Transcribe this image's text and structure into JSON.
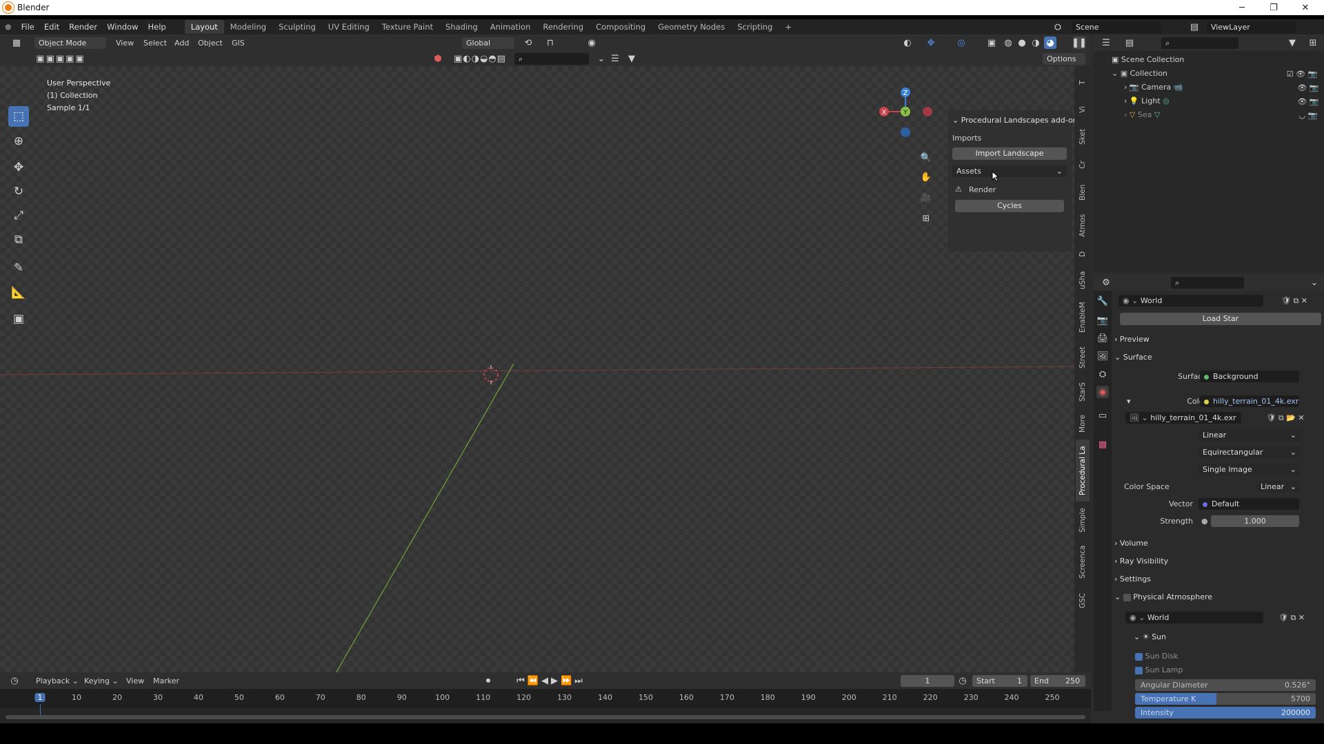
{
  "window": {
    "title": "Blender",
    "controls": [
      "─",
      "❐",
      "✕"
    ]
  },
  "menu": [
    "File",
    "Edit",
    "Render",
    "Window",
    "Help"
  ],
  "workspaces": [
    "Layout",
    "Modeling",
    "Sculpting",
    "UV Editing",
    "Texture Paint",
    "Shading",
    "Animation",
    "Rendering",
    "Compositing",
    "Geometry Nodes",
    "Scripting",
    "+"
  ],
  "active_workspace": "Layout",
  "scene": {
    "name": "Scene",
    "view_layer": "ViewLayer"
  },
  "header3d": {
    "mode": "Object Mode",
    "menus": [
      "View",
      "Select",
      "Add",
      "Object",
      "GIS"
    ],
    "orientation": "Global",
    "options": "Options"
  },
  "overlay_text": {
    "perspective": "User Perspective",
    "collection": "(1) Collection",
    "sample": "Sample 1/1"
  },
  "npanel": {
    "title": "Procedural Landscapes add-on",
    "imports_label": "Imports",
    "import_button": "Import Landscape",
    "assets": "Assets",
    "render_label": "Render",
    "cycles_button": "Cycles"
  },
  "vtabs": [
    "T",
    "Vi",
    "Sket",
    "Cr",
    "Blen",
    "Atmos",
    "D",
    "uSha",
    "EnableM",
    "Street",
    "StarS",
    "More",
    "Procedural La",
    "Simple",
    "Screenca",
    "GSC"
  ],
  "active_vtab": "Procedural La",
  "gizmo": {
    "z": "Z",
    "y": "Y",
    "x": "X"
  },
  "outliner": {
    "root": "Scene Collection",
    "collection": "Collection",
    "items": [
      "Camera",
      "Light",
      "Sea"
    ]
  },
  "properties": {
    "world_name": "World",
    "load_star": "Load Star",
    "preview": "Preview",
    "surface_section": "Surface",
    "surface_label": "Surface",
    "surface_value": "Background",
    "color_label": "Color",
    "color_value": "hilly_terrain_01_4k.exr",
    "image_name": "hilly_terrain_01_4k.exr",
    "interp": "Linear",
    "projection": "Equirectangular",
    "source": "Single Image",
    "colorspace_label": "Color Space",
    "colorspace_value": "Linear",
    "vector_label": "Vector",
    "vector_value": "Default",
    "strength_label": "Strength",
    "strength_value": "1.000",
    "volume": "Volume",
    "ray_visibility": "Ray Visibility",
    "settings": "Settings",
    "phys_atmo": "Physical Atmosphere",
    "atmo_world": "World",
    "sun": "Sun",
    "sun_disk": "Sun Disk",
    "sun_lamp": "Sun Lamp",
    "angular_label": "Angular Diameter",
    "angular_value": "0.526°",
    "temp_label": "Temperature K",
    "temp_value": "5700",
    "temp_fill": 0.45,
    "intensity_label": "Intensity",
    "intensity_value": "200000",
    "intensity_fill": 1.0
  },
  "timeline": {
    "menus": [
      "Playback",
      "Keying",
      "View",
      "Marker"
    ],
    "current_frame": "1",
    "start_label": "Start",
    "start": "1",
    "end_label": "End",
    "end": "250",
    "ticks": [
      "1",
      "10",
      "20",
      "30",
      "40",
      "50",
      "60",
      "70",
      "80",
      "90",
      "100",
      "110",
      "120",
      "130",
      "140",
      "150",
      "160",
      "170",
      "180",
      "190",
      "200",
      "210",
      "220",
      "230",
      "240",
      "250"
    ]
  },
  "colors": {
    "accent": "#4772b3",
    "x_axis": "#c8414b",
    "y_axis": "#8bc34a",
    "z_axis": "#3b82d6"
  }
}
